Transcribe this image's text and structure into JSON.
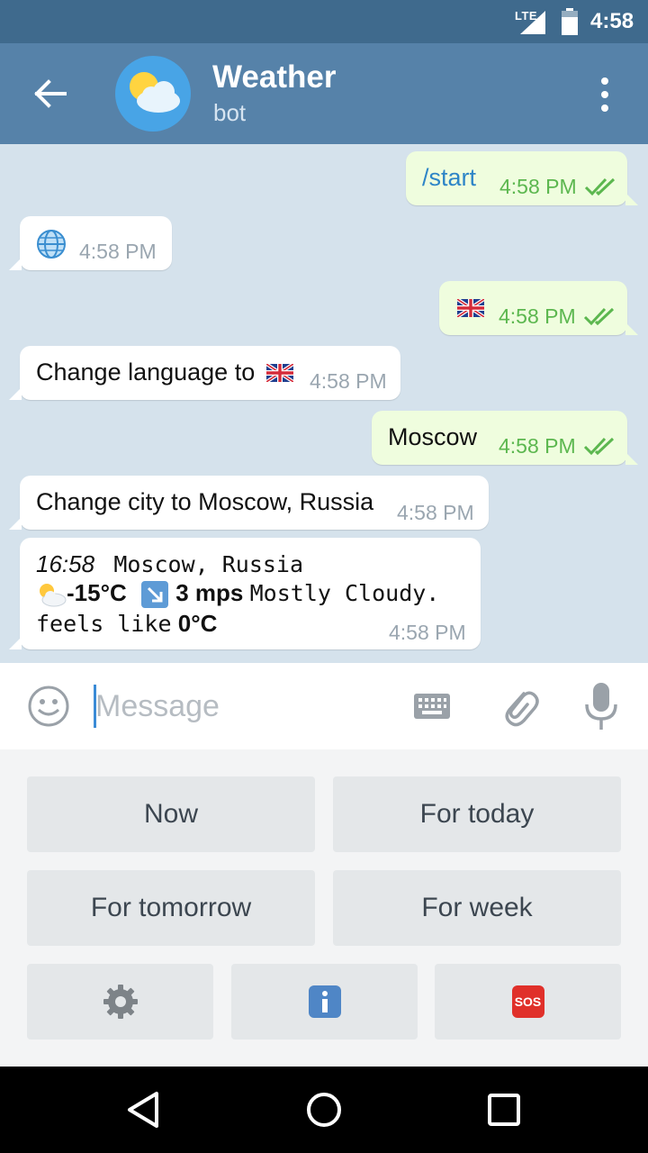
{
  "status_bar": {
    "network": "LTE",
    "time": "4:58"
  },
  "header": {
    "title": "Weather",
    "subtitle": "bot"
  },
  "messages": [
    {
      "dir": "out",
      "text": "/start",
      "time": "4:58 PM"
    },
    {
      "dir": "in",
      "icon": "globe-icon",
      "time": "4:58 PM"
    },
    {
      "dir": "out",
      "icon": "uk-flag-icon",
      "time": "4:58 PM"
    },
    {
      "dir": "in",
      "text": "Change language to",
      "icon": "uk-flag-icon",
      "time": "4:58 PM"
    },
    {
      "dir": "out",
      "text": "Moscow",
      "time": "4:58 PM"
    },
    {
      "dir": "in",
      "text": "Change city to Moscow, Russia",
      "time": "4:58 PM"
    },
    {
      "dir": "in",
      "weather": {
        "clock": "16:58",
        "city": "Moscow, Russia",
        "temp": "-15°C",
        "wind": "3 mps",
        "condition": "Mostly Cloudy.",
        "feels_label": "feels like",
        "feels_value": "0°C"
      },
      "time": "4:58 PM"
    }
  ],
  "input": {
    "placeholder": "Message"
  },
  "keyboard": {
    "now": "Now",
    "today": "For today",
    "tomorrow": "For tomorrow",
    "week": "For week",
    "icons": [
      "gear-icon",
      "info-icon",
      "sos-icon"
    ],
    "sos_label": "SOS"
  },
  "colors": {
    "header": "#5682a9",
    "status": "#3f6a8d",
    "chat_bg": "#d5e2ec",
    "out_bubble": "#effdde",
    "link": "#2e85c7",
    "check": "#5cb74f"
  }
}
